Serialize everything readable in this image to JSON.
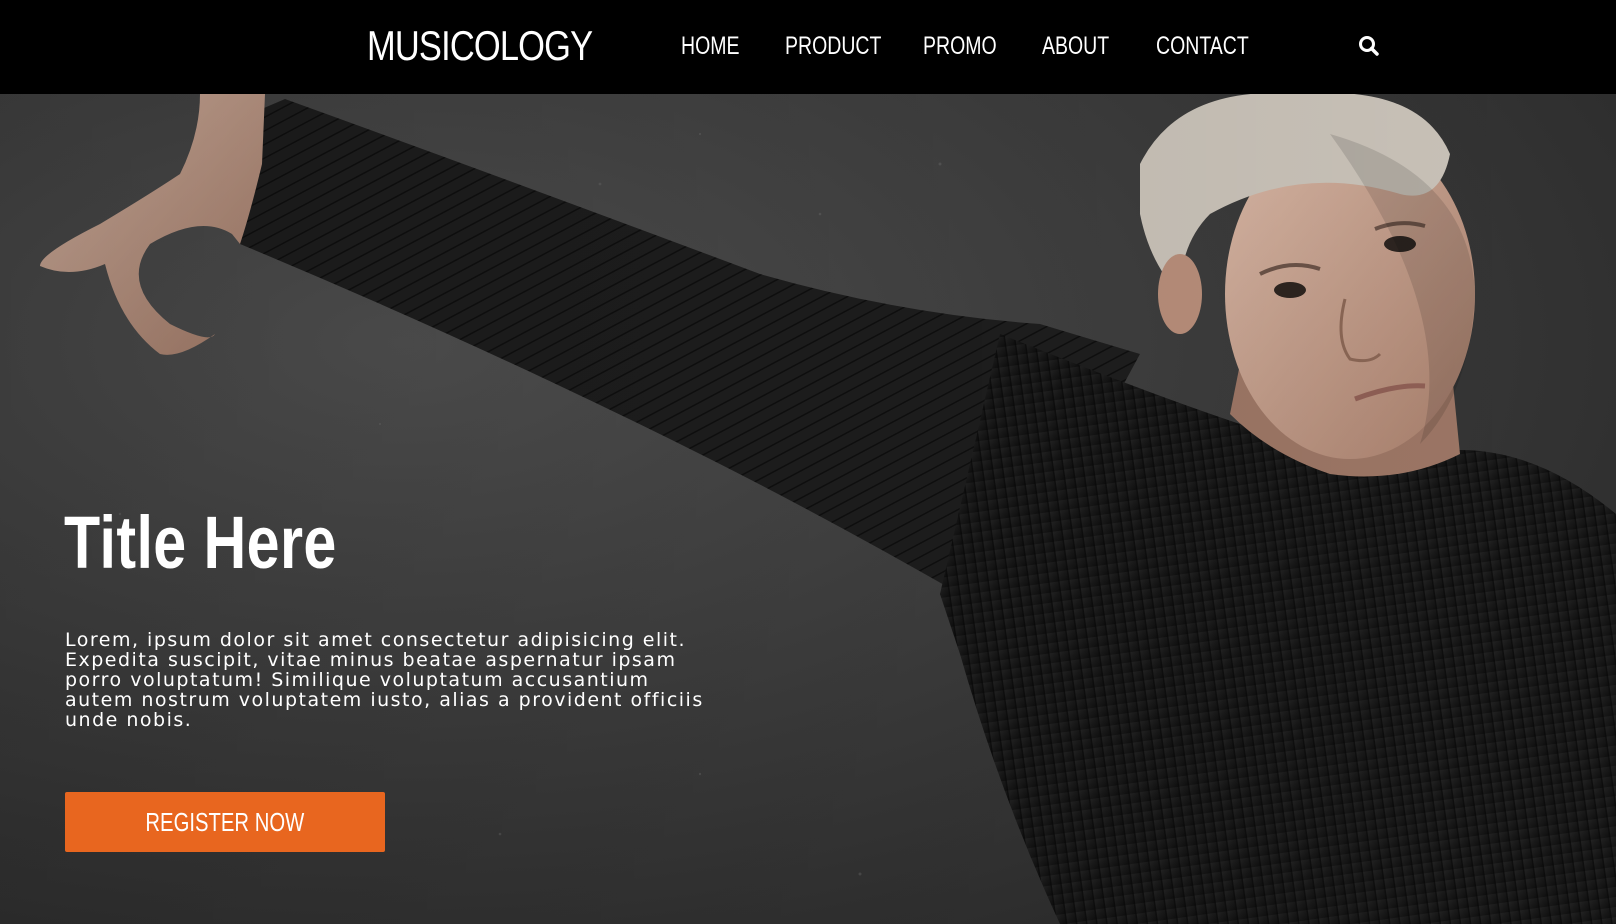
{
  "header": {
    "brand": "MUSICOLOGY",
    "nav": [
      {
        "label": "HOME"
      },
      {
        "label": "PRODUCT"
      },
      {
        "label": "PROMO"
      },
      {
        "label": "ABOUT"
      },
      {
        "label": "CONTACT"
      }
    ],
    "search_icon": "search-icon"
  },
  "hero": {
    "title": "Title Here",
    "text": "Lorem, ipsum dolor sit amet consectetur adipisicing elit. Expedita suscipit, vitae minus beatae aspernatur ipsam porro voluptatum! Similique voluptatum accusantium autem nostrum voluptatem iusto, alias a provident officiis unde nobis.",
    "cta_label": "REGISTER NOW"
  },
  "colors": {
    "nav_background": "#000000",
    "accent": "#e8661f",
    "text": "#ffffff"
  }
}
